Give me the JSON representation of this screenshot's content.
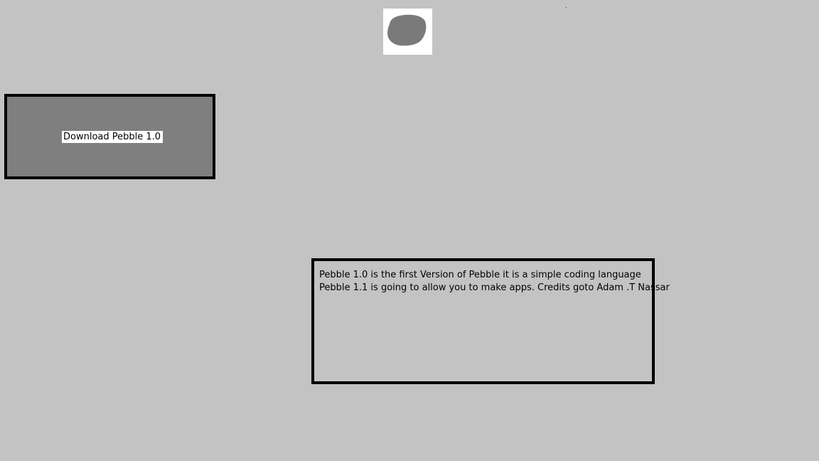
{
  "logo": {
    "icon": "pebble-logo-icon",
    "fill_color": "#7a7a7a",
    "background_color": "#ffffff"
  },
  "download_button": {
    "label": "Download Pebble 1.0",
    "background_color": "#7f7f7f",
    "border_color": "#000000"
  },
  "info_box": {
    "lines": [
      "Pebble 1.0 is the first Version of Pebble it is a simple coding language",
      "Pebble 1.1 is going to allow you to make apps. Credits goto Adam .T Nassar"
    ],
    "border_color": "#000000"
  },
  "page": {
    "background_color": "#c3c3c3"
  }
}
